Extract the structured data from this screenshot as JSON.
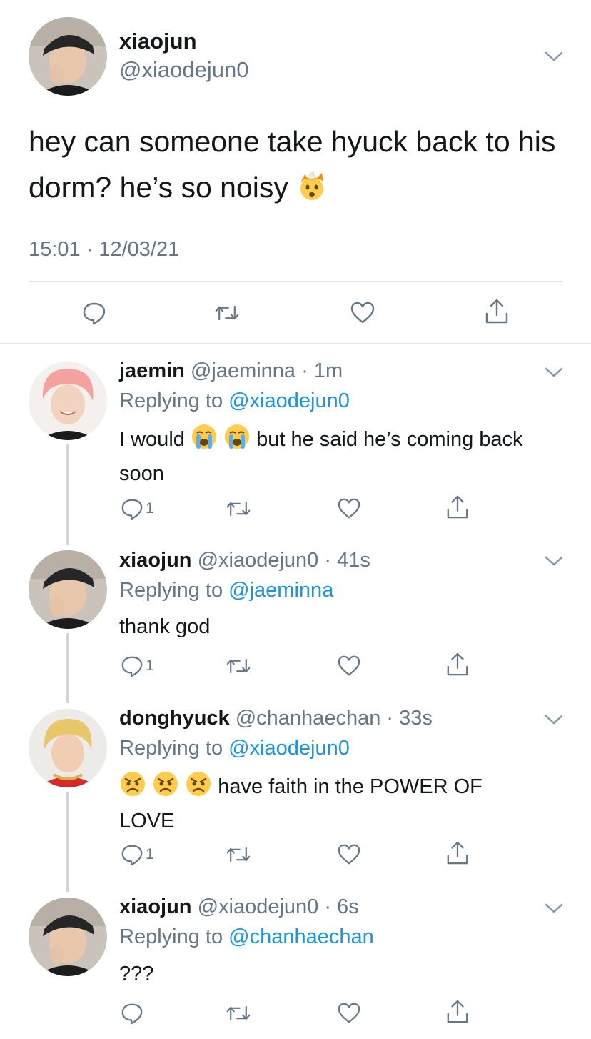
{
  "main_tweet": {
    "display_name": "xiaojun",
    "handle": "@xiaodejun0",
    "text": "hey can someone take hyuck back to his dorm? he’s so noisy",
    "emoji_icon": "exploding-head-emoji",
    "timestamp": "15:01 · 12/03/21"
  },
  "replies": [
    {
      "display_name": "jaemin",
      "handle": "@jaeminna",
      "time": "· 1m",
      "replying_label": "Replying to",
      "replying_to": "@xiaodejun0",
      "text_before": "I would",
      "emoji_icons": [
        "loudly-crying-emoji",
        "loudly-crying-emoji"
      ],
      "text_after": "but he said he’s coming back soon",
      "reply_count": "1"
    },
    {
      "display_name": "xiaojun",
      "handle": "@xiaodejun0",
      "time": "· 41s",
      "replying_label": "Replying to",
      "replying_to": "@jaeminna",
      "text": "thank god",
      "reply_count": "1"
    },
    {
      "display_name": "donghyuck",
      "handle": "@chanhaechan",
      "time": "· 33s",
      "replying_label": "Replying to",
      "replying_to": "@xiaodejun0",
      "emoji_icons": [
        "angry-face-emoji",
        "angry-face-emoji",
        "angry-face-emoji"
      ],
      "text_after": "have faith in the POWER OF LOVE",
      "reply_count": "1"
    },
    {
      "display_name": "xiaojun",
      "handle": "@xiaodejun0",
      "time": "· 6s",
      "replying_label": "Replying to",
      "replying_to": "@chanhaechan",
      "text": "???",
      "reply_count": ""
    }
  ],
  "colors": {
    "text": "#14171a",
    "muted": "#657786",
    "link": "#1b95e0",
    "divider": "#e1e8ed",
    "thread_line": "#ccd6dd"
  }
}
